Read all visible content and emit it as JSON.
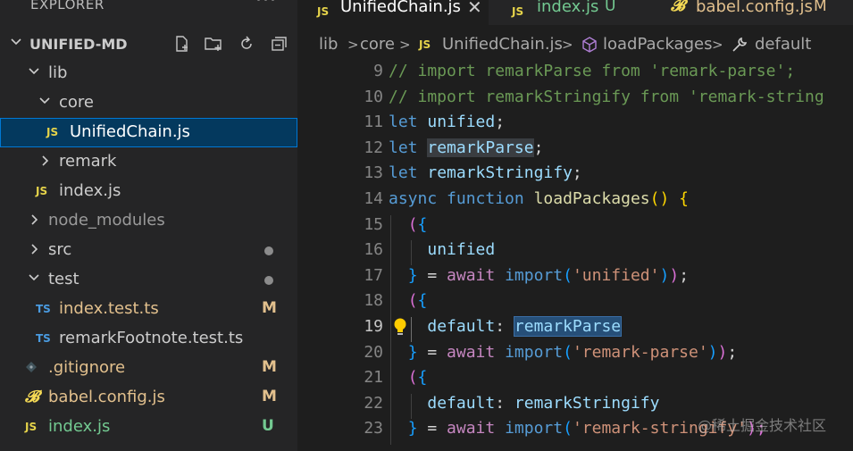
{
  "explorer": {
    "title": "EXPLORER",
    "more_icon": "more-icon",
    "root": "UNIFIED-MD",
    "items": [
      {
        "label": "lib",
        "kind": "folder-open"
      },
      {
        "label": "core",
        "kind": "folder-open"
      },
      {
        "label": "UnifiedChain.js",
        "kind": "js",
        "selected": true
      },
      {
        "label": "remark",
        "kind": "folder-closed"
      },
      {
        "label": "index.js",
        "kind": "js"
      },
      {
        "label": "node_modules",
        "kind": "folder-closed"
      },
      {
        "label": "src",
        "kind": "folder-closed"
      },
      {
        "label": "test",
        "kind": "folder-open"
      },
      {
        "label": "index.test.ts",
        "kind": "ts",
        "badge": "M"
      },
      {
        "label": "remarkFootnote.test.ts",
        "kind": "ts"
      },
      {
        "label": ".gitignore",
        "kind": "git",
        "badge": "M"
      },
      {
        "label": "babel.config.js",
        "kind": "babel",
        "badge": "M"
      },
      {
        "label": "index.js",
        "kind": "js",
        "badge": "U"
      }
    ],
    "icon_labels": {
      "js": "JS",
      "ts": "TS"
    }
  },
  "tabs": [
    {
      "label": "UnifiedChain.js",
      "active": true
    },
    {
      "label": "index.js",
      "status": "U"
    },
    {
      "label": "babel.config.js",
      "status": "M"
    }
  ],
  "breadcrumb": {
    "parts": [
      "lib",
      "core",
      "UnifiedChain.js",
      "loadPackages",
      "default"
    ],
    "sep": ">"
  },
  "code": {
    "line_numbers": [
      "9",
      "10",
      "11",
      "12",
      "13",
      "14",
      "15",
      "16",
      "17",
      "18",
      "19",
      "20",
      "21",
      "22",
      "23"
    ],
    "current_line": "19",
    "tokens": {
      "l9": "// import remarkParse from 'remark-parse';",
      "l10": "// import remarkStringify from 'remark-string",
      "let": "let",
      "unified": "unified",
      "remarkParse": "remarkParse",
      "remarkStringify": "remarkStringify",
      "semi": ";",
      "async": "async",
      "function": "function",
      "loadPackages": "loadPackages",
      "lp": "(",
      "rp": ")",
      "lb": "{",
      "rb": "}",
      "eq": " = ",
      "await": "await",
      "import": "import",
      "s_unified": "'unified'",
      "s_parse": "'remark-parse'",
      "s_stringify": "'remark-stringify'",
      "default": "default",
      "colon": ": ",
      "close_semi": ");"
    }
  },
  "colors": {
    "bg": "#1e1e1e",
    "sidebar": "#252526",
    "selection": "#04395e",
    "js_icon": "#e5d34a",
    "ts_icon": "#4a9be0",
    "modified": "#e2c08d",
    "untracked": "#73c991"
  },
  "watermark": "@稀土掘金技术社区"
}
